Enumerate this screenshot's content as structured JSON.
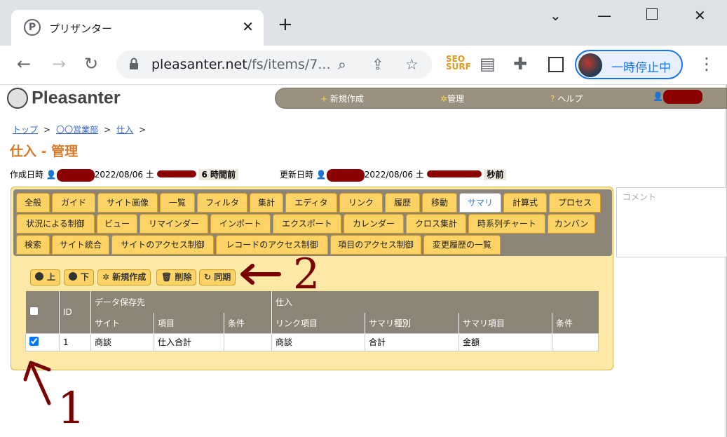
{
  "browser": {
    "tab_title": "プリザンター",
    "favicon_letter": "P",
    "url_host": "pleasanter.net",
    "url_path": "/fs/items/7...",
    "profile_label": "一時停止中"
  },
  "app": {
    "logo": "Pleasanter",
    "nav": {
      "new": "新規作成",
      "manage": "管理",
      "help": "ヘルプ"
    }
  },
  "breadcrumb": [
    "トップ",
    "〇〇営業部",
    "仕入"
  ],
  "page_title": "仕入 - 管理",
  "meta": {
    "created_label": "作成日時",
    "created_date": "2022/08/06 土",
    "created_ago": "6 時間前",
    "updated_label": "更新日時",
    "updated_date": "2022/08/06 土",
    "updated_ago": "秒前"
  },
  "tabs_row1": [
    "全般",
    "ガイド",
    "サイト画像",
    "一覧",
    "フィルタ",
    "集計",
    "エディタ",
    "リンク",
    "履歴",
    "移動",
    "サマリ",
    "計算式",
    "プロセス"
  ],
  "tabs_row2": [
    "状況による制御",
    "ビュー",
    "リマインダー",
    "インポート",
    "エクスポート",
    "カレンダー",
    "クロス集計",
    "時系列チャート",
    "カンバン"
  ],
  "tabs_row3": [
    "検索",
    "サイト統合",
    "サイトのアクセス制御",
    "レコードのアクセス制御",
    "項目のアクセス制御",
    "変更履歴の一覧"
  ],
  "active_tab": "サマリ",
  "buttons": {
    "up": "上",
    "down": "下",
    "new": "新規作成",
    "delete": "削除",
    "sync": "同期"
  },
  "table": {
    "group_dest": "データ保存先",
    "group_src": "仕入",
    "col_id": "ID",
    "columns": [
      "サイト",
      "項目",
      "条件",
      "リンク項目",
      "サマリ種別",
      "サマリ項目",
      "条件"
    ],
    "rows": [
      {
        "checked": true,
        "id": "1",
        "site": "商談",
        "item": "仕入合計",
        "cond": "",
        "link": "商談",
        "type": "合計",
        "sum_item": "金額",
        "cond2": ""
      }
    ]
  },
  "comment_placeholder": "コメント",
  "annotations": {
    "one": "1",
    "two": "2"
  }
}
